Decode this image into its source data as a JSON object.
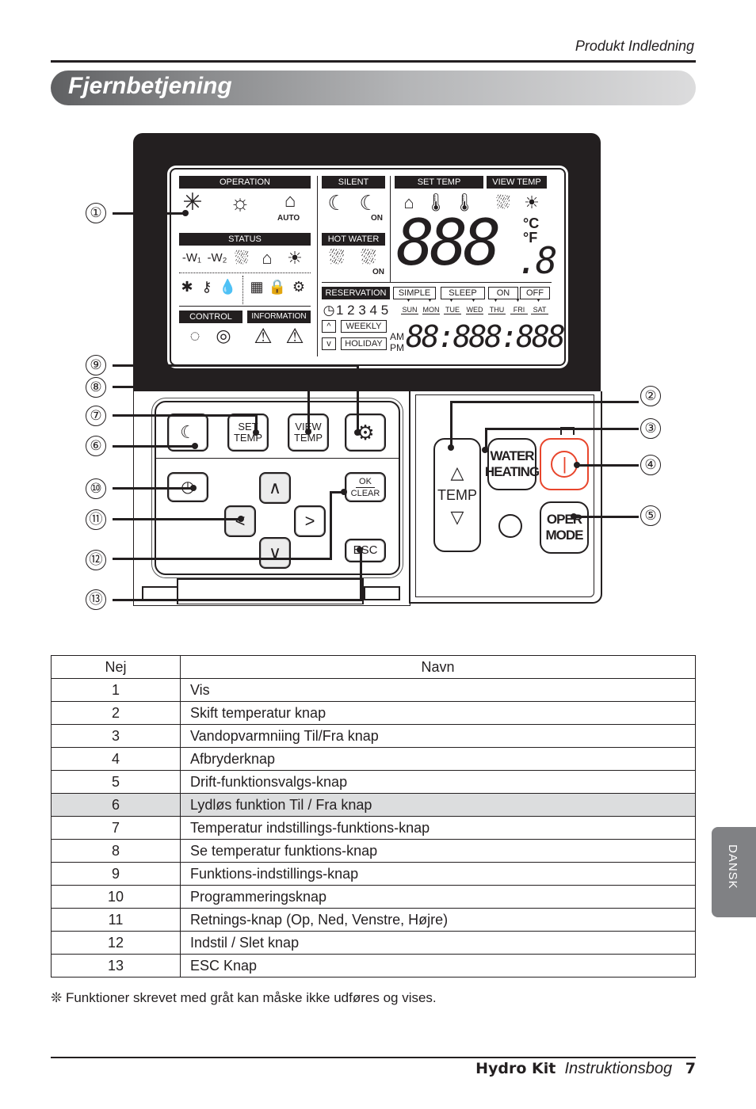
{
  "header": {
    "section": "Produkt Indledning",
    "title": "Fjernbetjening"
  },
  "lcd": {
    "labels": {
      "operation": "OPERATION",
      "status": "STATUS",
      "control": "CONTROL",
      "information": "INFORMATION",
      "silent": "SILENT",
      "hot_water": "HOT WATER",
      "set_temp": "SET TEMP",
      "view_temp": "VIEW TEMP",
      "reservation": "RESERVATION"
    },
    "auto": "AUTO",
    "on": "ON",
    "temp_digits": "888",
    "temp_decimal": ".8",
    "unit_c": "°C",
    "unit_f": "°F",
    "modes": [
      "SIMPLE",
      "SLEEP",
      "ON",
      "OFF"
    ],
    "program_numbers": "1 2 3 4 5",
    "weekly": "WEEKLY",
    "holiday": "HOLIDAY",
    "am": "AM",
    "pm": "PM",
    "days": [
      "SUN",
      "MON",
      "TUE",
      "WED",
      "THU",
      "FRI",
      "SAT"
    ],
    "clock_digits": "88:888:888"
  },
  "keypad": {
    "set_temp": [
      "SET",
      "TEMP"
    ],
    "view_temp": [
      "VIEW",
      "TEMP"
    ],
    "ok": "OK",
    "clear": "CLEAR",
    "esc": "ESC"
  },
  "side_panel": {
    "temp": "TEMP",
    "water_heating": [
      "WATER",
      "HEATING"
    ],
    "oper_mode": [
      "OPER",
      "MODE"
    ]
  },
  "callouts": [
    "①",
    "②",
    "③",
    "④",
    "⑤",
    "⑥",
    "⑦",
    "⑧",
    "⑨",
    "⑩",
    "⑪",
    "⑫",
    "⑬"
  ],
  "table": {
    "headers": [
      "Nej",
      "Navn"
    ],
    "rows": [
      {
        "no": "1",
        "name": "Vis"
      },
      {
        "no": "2",
        "name": "Skift temperatur knap"
      },
      {
        "no": "3",
        "name": "Vandopvarmniing Til/Fra knap"
      },
      {
        "no": "4",
        "name": "Afbryderknap"
      },
      {
        "no": "5",
        "name": "Drift-funktionsvalgs-knap"
      },
      {
        "no": "6",
        "name": "Lydløs funktion Til / Fra knap"
      },
      {
        "no": "7",
        "name": "Temperatur indstillings-funktions-knap"
      },
      {
        "no": "8",
        "name": "Se temperatur funktions-knap"
      },
      {
        "no": "9",
        "name": "Funktions-indstillings-knap"
      },
      {
        "no": "10",
        "name": "Programmeringsknap"
      },
      {
        "no": "11",
        "name": "Retnings-knap (Op, Ned, Venstre, Højre)"
      },
      {
        "no": "12",
        "name": "Indstil / Slet knap"
      },
      {
        "no": "13",
        "name": "ESC Knap"
      }
    ],
    "highlighted_row": "6"
  },
  "note": "❊ Funktioner skrevet med gråt kan måske ikke udføres og vises.",
  "footer": {
    "product": "Hydro Kit",
    "doc": "Instruktionsbog",
    "page": "7"
  },
  "language_tab": "DANSK",
  "colors": {
    "text": "#231f20",
    "power_accent": "#e8452c",
    "highlight_row": "#dcddde",
    "lang_tab": "#808184"
  }
}
